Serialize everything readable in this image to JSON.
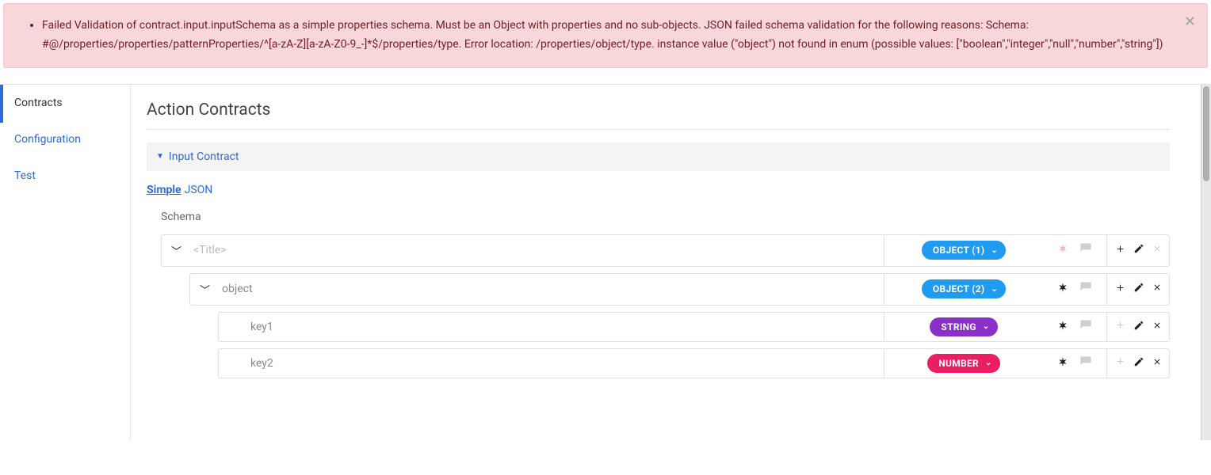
{
  "alert": {
    "message": "Failed Validation of contract.input.inputSchema as a simple properties schema. Must be an Object with properties and no sub-objects. JSON failed schema validation for the following reasons: Schema: #@/properties/properties/patternProperties/^[a-zA-Z][a-zA-Z0-9_-]*$/properties/type. Error location: /properties/object/type. instance value (\"object\") not found in enum (possible values: [\"boolean\",\"integer\",\"null\",\"number\",\"string\"])"
  },
  "sidebar": {
    "items": [
      {
        "label": "Contracts",
        "active": true
      },
      {
        "label": "Configuration",
        "active": false
      },
      {
        "label": "Test",
        "active": false
      }
    ]
  },
  "page": {
    "title": "Action Contracts",
    "section": "Input Contract",
    "tabs": {
      "simple": "Simple",
      "json": "JSON"
    },
    "schemaLabel": "Schema"
  },
  "schema": {
    "rows": [
      {
        "name": "<Title>",
        "placeholder": true,
        "type": "OBJECT (1)",
        "typeClass": "blue",
        "expandable": true,
        "indent": 0,
        "reqDisabled": true,
        "addDisabled": false,
        "delDisabled": true
      },
      {
        "name": "object",
        "placeholder": false,
        "type": "OBJECT (2)",
        "typeClass": "blue",
        "expandable": true,
        "indent": 1,
        "reqDisabled": false,
        "addDisabled": false,
        "delDisabled": false
      },
      {
        "name": "key1",
        "placeholder": false,
        "type": "STRING",
        "typeClass": "purple",
        "expandable": false,
        "indent": 2,
        "reqDisabled": false,
        "addDisabled": true,
        "delDisabled": false
      },
      {
        "name": "key2",
        "placeholder": false,
        "type": "NUMBER",
        "typeClass": "pink",
        "expandable": false,
        "indent": 2,
        "reqDisabled": false,
        "addDisabled": true,
        "delDisabled": false
      }
    ]
  }
}
